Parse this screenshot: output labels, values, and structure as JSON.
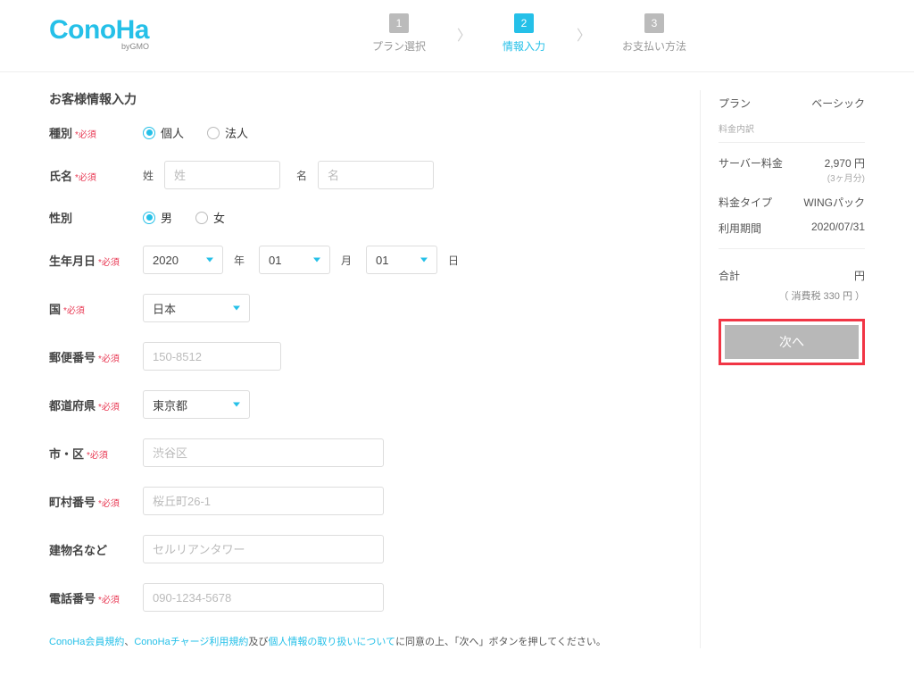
{
  "logo": {
    "main": "ConoHa",
    "sub": "byGMO"
  },
  "steps": [
    {
      "num": "1",
      "label": "プラン選択"
    },
    {
      "num": "2",
      "label": "情報入力"
    },
    {
      "num": "3",
      "label": "お支払い方法"
    }
  ],
  "section_title": "お客様情報入力",
  "required_mark": "*必須",
  "labels": {
    "type": "種別",
    "name": "氏名",
    "gender": "性別",
    "birthdate": "生年月日",
    "country": "国",
    "postal": "郵便番号",
    "prefecture": "都道府県",
    "city": "市・区",
    "town": "町村番号",
    "building": "建物名など",
    "phone": "電話番号"
  },
  "type_options": {
    "individual": "個人",
    "corporate": "法人"
  },
  "name_sub": {
    "last": "姓",
    "first": "名"
  },
  "name_placeholder": {
    "last": "姓",
    "first": "名"
  },
  "gender_options": {
    "male": "男",
    "female": "女"
  },
  "birthdate": {
    "year": "2020",
    "month": "01",
    "day": "01"
  },
  "birthdate_unit": {
    "year": "年",
    "month": "月",
    "day": "日"
  },
  "country_value": "日本",
  "postal_placeholder": "150-8512",
  "prefecture_value": "東京都",
  "city_placeholder": "渋谷区",
  "town_placeholder": "桜丘町26-1",
  "building_placeholder": "セルリアンタワー",
  "phone_placeholder": "090-1234-5678",
  "sidebar": {
    "plan_label": "プラン",
    "plan_value": "ベーシック",
    "breakdown_label": "料金内訳",
    "server_fee_label": "サーバー料金",
    "server_fee_value": "2,970 円",
    "server_fee_note": "(3ヶ月分)",
    "fee_type_label": "料金タイプ",
    "fee_type_value": "WINGパック",
    "period_label": "利用期間",
    "period_value": "2020/07/31",
    "total_label": "合計",
    "total_value": "円",
    "tax": "（ 消費税 330 円 ）",
    "next": "次へ"
  },
  "agreement": {
    "link1": "ConoHa会員規約",
    "sep1": "、",
    "link2": "ConoHaチャージ利用規約",
    "sep2": "及び",
    "link3": "個人情報の取り扱いについて",
    "rest": "に同意の上、「次へ」ボタンを押してください。"
  }
}
